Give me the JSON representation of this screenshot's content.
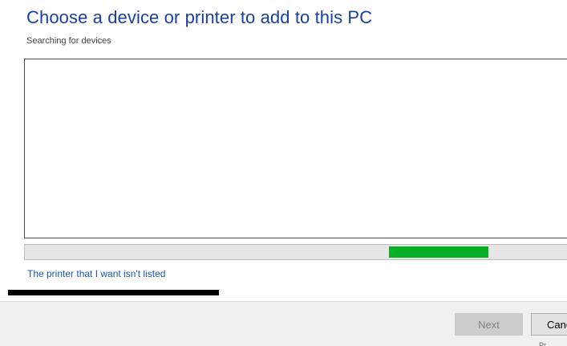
{
  "window": {
    "title": "Choose a device or printer to add to this PC",
    "status": "Searching for devices"
  },
  "device_list": {
    "items": []
  },
  "search_progress": {
    "indeterminate": true,
    "indicator_start_fraction": 0.66,
    "indicator_length_fraction": 0.18,
    "color": "#06b025"
  },
  "links": {
    "not_listed": "The printer that I want isn't listed"
  },
  "buttons": {
    "next": {
      "label": "Next",
      "enabled": false
    },
    "cancel": {
      "label": "Cancel",
      "enabled": true
    }
  },
  "colors": {
    "title": "#1a3fa3",
    "link": "#1a55b5",
    "footer_background": "#f0f0f0"
  }
}
